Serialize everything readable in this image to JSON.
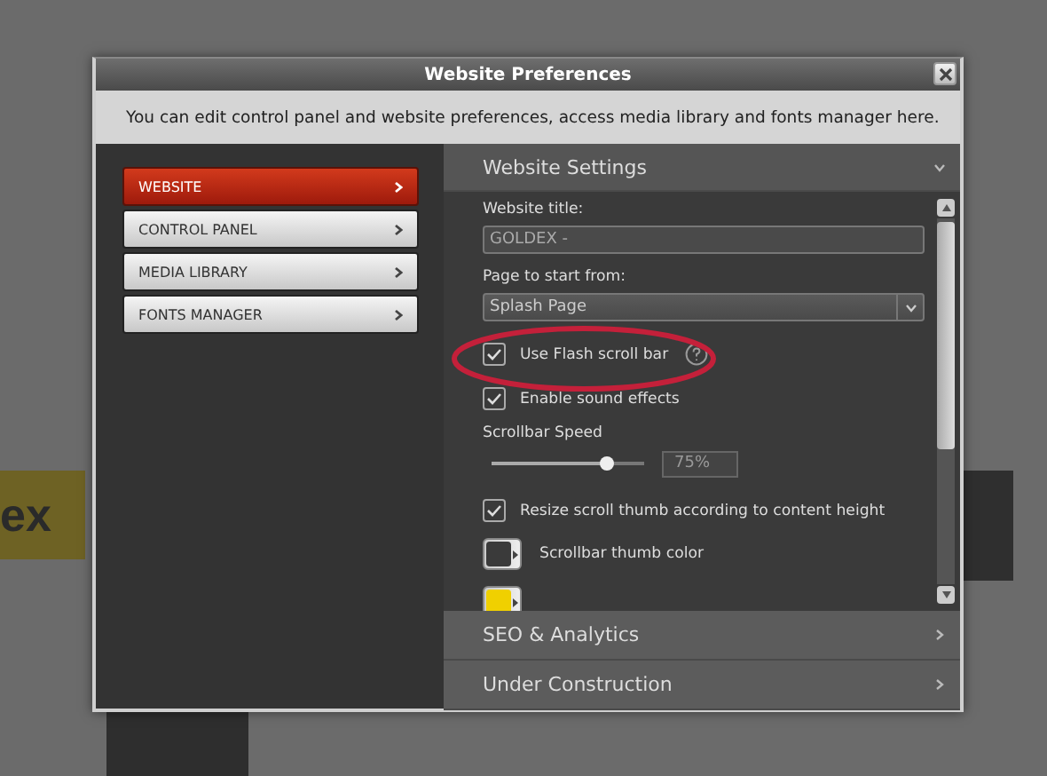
{
  "background": {
    "label": "ex"
  },
  "window": {
    "title": "Website Preferences",
    "description": "You can edit control panel and website preferences, access media library and fonts manager here."
  },
  "sidebar": {
    "items": [
      {
        "label": "WEBSITE",
        "selected": true
      },
      {
        "label": "CONTROL PANEL",
        "selected": false
      },
      {
        "label": "MEDIA LIBRARY",
        "selected": false
      },
      {
        "label": "FONTS MANAGER",
        "selected": false
      }
    ]
  },
  "panel": {
    "sections": [
      {
        "title": "Website Settings",
        "expanded": true,
        "settings": [
          {
            "kind": "text",
            "label": "Website title:",
            "value": "GOLDEX -"
          },
          {
            "kind": "select",
            "label": "Page to start from:",
            "value": "Splash Page"
          },
          {
            "kind": "checkbox",
            "label": "Use Flash scroll bar",
            "checked": true,
            "help": true,
            "highlighted": true
          },
          {
            "kind": "checkbox",
            "label": "Enable sound effects",
            "checked": true
          },
          {
            "kind": "slider",
            "label": "Scrollbar Speed",
            "level": 0.75,
            "reading": "75%"
          },
          {
            "kind": "checkbox",
            "label": "Resize scroll thumb according to content height",
            "checked": true
          },
          {
            "kind": "color",
            "label": "Scrollbar thumb color",
            "color": "#3a3a3a"
          },
          {
            "kind": "color",
            "color": "#f0d000"
          }
        ]
      },
      {
        "title": "SEO & Analytics",
        "expanded": false
      },
      {
        "title": "Under Construction",
        "expanded": false
      }
    ]
  }
}
